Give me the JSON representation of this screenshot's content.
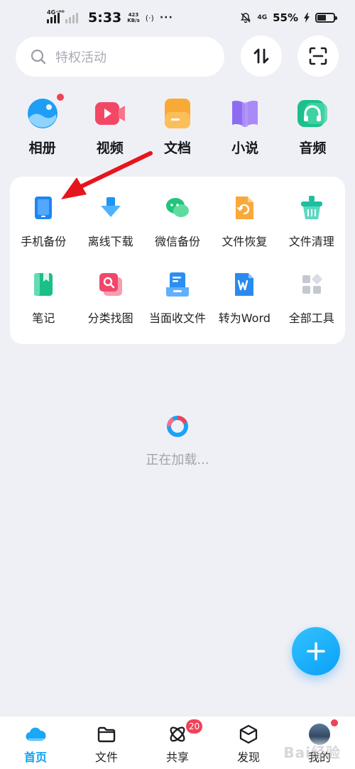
{
  "status_bar": {
    "network_label": "4G⁺ᴴᴰ",
    "time": "5:33",
    "speed_value": "423",
    "speed_unit": "KB/s",
    "hotspot": "(·)",
    "dots": "···",
    "network_right": "4G",
    "battery_percent": "55%",
    "battery_level": 0.55
  },
  "search": {
    "placeholder": "特权活动"
  },
  "categories": [
    {
      "label": "相册",
      "icon": "photo-album-icon",
      "color": "#1e9ef5",
      "has_dot": true
    },
    {
      "label": "视频",
      "icon": "video-icon",
      "color": "#f24866"
    },
    {
      "label": "文档",
      "icon": "document-icon",
      "color": "#f9a935"
    },
    {
      "label": "小说",
      "icon": "novel-book-icon",
      "color": "#8e6cf2"
    },
    {
      "label": "音频",
      "icon": "audio-headphone-icon",
      "color": "#1cc08c"
    }
  ],
  "tools": [
    {
      "label": "手机备份",
      "icon": "phone-backup-icon",
      "color": "#1d86f0"
    },
    {
      "label": "离线下载",
      "icon": "offline-download-icon",
      "color": "#1e94f3"
    },
    {
      "label": "微信备份",
      "icon": "wechat-backup-icon",
      "color": "#22c47b"
    },
    {
      "label": "文件恢复",
      "icon": "file-restore-icon",
      "color": "#f8a93a"
    },
    {
      "label": "文件清理",
      "icon": "file-clean-icon",
      "color": "#1cbfa0"
    },
    {
      "label": "笔记",
      "icon": "notes-icon",
      "color": "#1bbf8a"
    },
    {
      "label": "分类找图",
      "icon": "image-search-icon",
      "color": "#f0476a"
    },
    {
      "label": "当面收文件",
      "icon": "receive-file-icon",
      "color": "#2a8ff0"
    },
    {
      "label": "转为Word",
      "icon": "word-convert-icon",
      "color": "#2a8af0"
    },
    {
      "label": "全部工具",
      "icon": "all-tools-icon",
      "color": "#c5c8d0"
    }
  ],
  "loading": {
    "text": "正在加载..."
  },
  "bottom_nav": [
    {
      "label": "首页",
      "icon": "home-cloud-icon",
      "active": true
    },
    {
      "label": "文件",
      "icon": "folder-icon"
    },
    {
      "label": "共享",
      "icon": "share-atom-icon",
      "badge": "20"
    },
    {
      "label": "发现",
      "icon": "discover-cube-icon"
    },
    {
      "label": "我的",
      "icon": "profile-avatar-icon",
      "has_dot": true
    }
  ],
  "watermark": "Bai经验",
  "colors": {
    "accent": "#0c9ff5",
    "badge": "#f04257",
    "arrow": "#e8141c"
  }
}
